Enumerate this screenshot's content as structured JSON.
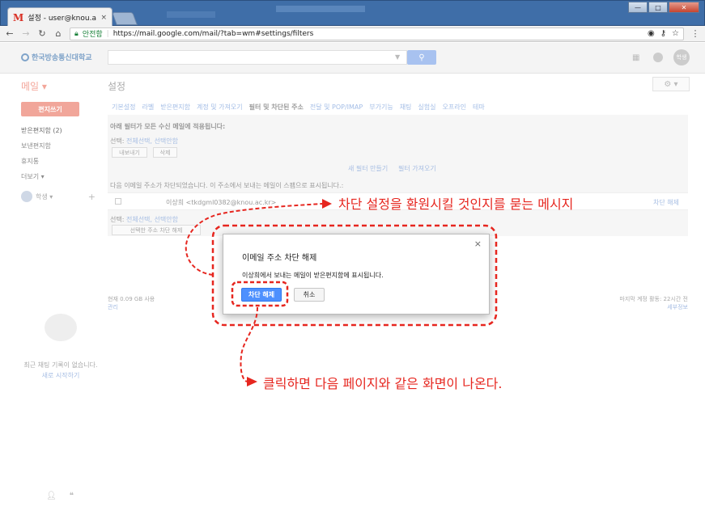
{
  "browser": {
    "tab_title": "설정 - user@knou.ac.kr",
    "tab_close": "×",
    "secure_label": "안전함",
    "url": "https://mail.google.com/mail/?tab=wm#settings/filters",
    "window_buttons": [
      "—",
      "□",
      "✕"
    ]
  },
  "header": {
    "logo_text": "한국방송통신대학교",
    "avatar_text": "학생"
  },
  "sidebar": {
    "mail_label": "메일 ▾",
    "compose_label": "편지쓰기",
    "items": [
      "받은편지함 (2)",
      "보낸편지함",
      "휴지통",
      "더보기 ▾"
    ],
    "user_label": "학생 ▾",
    "chat_empty": "최근 채팅 기록이 없습니다.",
    "chat_new": "새로 시작하기"
  },
  "settings": {
    "title": "설정",
    "tabs": [
      "기본설정",
      "라벨",
      "받은편지함",
      "계정 및 가져오기",
      "필터 및 차단된 주소",
      "전달 및 POP/IMAP",
      "부가기능",
      "채팅",
      "실험실",
      "오프라인",
      "테마"
    ],
    "current_tab_index": 4,
    "filter_heading": "아래 필터가 모든 수신 메일에 적용됩니다:",
    "select_label": "선택:",
    "select_links": "전체선택, 선택안함",
    "export_btn": "내보내기",
    "delete_btn": "삭제",
    "create_filter": "새 필터 만들기",
    "import_filter": "필터 가져오기",
    "blocked_heading": "다음 이메일 주소가 차단되었습니다. 이 주소에서 보내는 메일이 스팸으로 표시됩니다.:",
    "blocked_name": "이상희",
    "blocked_email": "<tkdgml0382@knou.ac.kr>",
    "unblock_link": "차단 해제",
    "unblock_selected_btn": "선택한 주소 차단 해제",
    "storage": "현재 0.09 GB 사용",
    "manage": "관리",
    "last_activity": "마지막 계정 활동: 22시간 전",
    "details": "세부정보"
  },
  "dialog": {
    "close": "×",
    "title": "이메일 주소 차단 해제",
    "message": "이상희에서 보내는 메일이 받은편지함에 표시됩니다.",
    "confirm": "차단 해제",
    "cancel": "취소"
  },
  "annotations": {
    "top": "차단 설정을 환원시킬 것인지를 묻는 메시지",
    "bottom": "클릭하면 다음 페이지와 같은 화면이 나온다."
  },
  "colors": {
    "annotation": "#e6261f",
    "primary_button": "#4d90fe"
  }
}
